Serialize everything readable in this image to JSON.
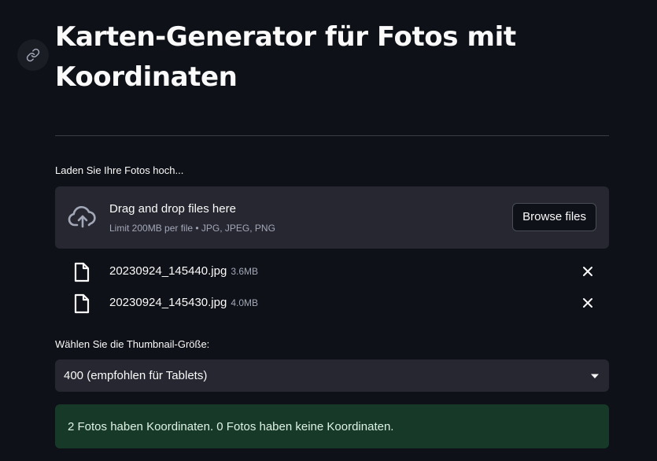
{
  "page": {
    "title": "Karten-Generator für Fotos mit Koordinaten"
  },
  "uploader": {
    "label": "Laden Sie Ihre Fotos hoch...",
    "drop_title": "Drag and drop files here",
    "limit_text": "Limit 200MB per file • JPG, JPEG, PNG",
    "browse_label": "Browse files",
    "icon": "cloud-upload-icon",
    "files": [
      {
        "name": "20230924_145440.jpg",
        "size": "3.6MB"
      },
      {
        "name": "20230924_145430.jpg",
        "size": "4.0MB"
      }
    ]
  },
  "thumbnail": {
    "label": "Wählen Sie die Thumbnail-Größe:",
    "selected": "400 (empfohlen für Tablets)"
  },
  "status": {
    "message": "2 Fotos haben Koordinaten. 0 Fotos haben keine Koordinaten."
  },
  "colors": {
    "background": "#0e1117",
    "widget": "#262730",
    "success_bg": "#173928"
  }
}
